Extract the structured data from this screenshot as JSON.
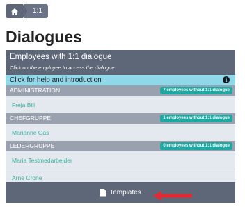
{
  "breadcrumb": {
    "home_icon": "home-icon",
    "current": "1:1"
  },
  "page": {
    "title": "Dialogues"
  },
  "panel": {
    "title": "Employees with 1:1 dialogue",
    "subtitle": "Click on the employee to access the dialogue",
    "help_text": "Click for help and introduction",
    "info_icon": "info-icon",
    "groups": [
      {
        "name": "ADMINISTRATION",
        "badge": "7 employees without 1:1 dialogue",
        "employees": [
          "Freja Bill"
        ]
      },
      {
        "name": "CHEFGRUPPE",
        "badge": "1 employees without 1:1 dialogue",
        "employees": [
          "Marianne Gas"
        ]
      },
      {
        "name": "LEDERGRUPPE",
        "badge": "0 employees without 1:1 dialogue",
        "employees": [
          "Maria Testmedarbejder",
          "Arne Crone"
        ]
      }
    ],
    "footer_label": "Templates",
    "footer_icon": "document-icon"
  },
  "colors": {
    "header": "#5e6778",
    "help": "#8fd8ea",
    "badge": "#1fa7a1",
    "link": "#3bb09d",
    "arrow": "#e02b35"
  }
}
